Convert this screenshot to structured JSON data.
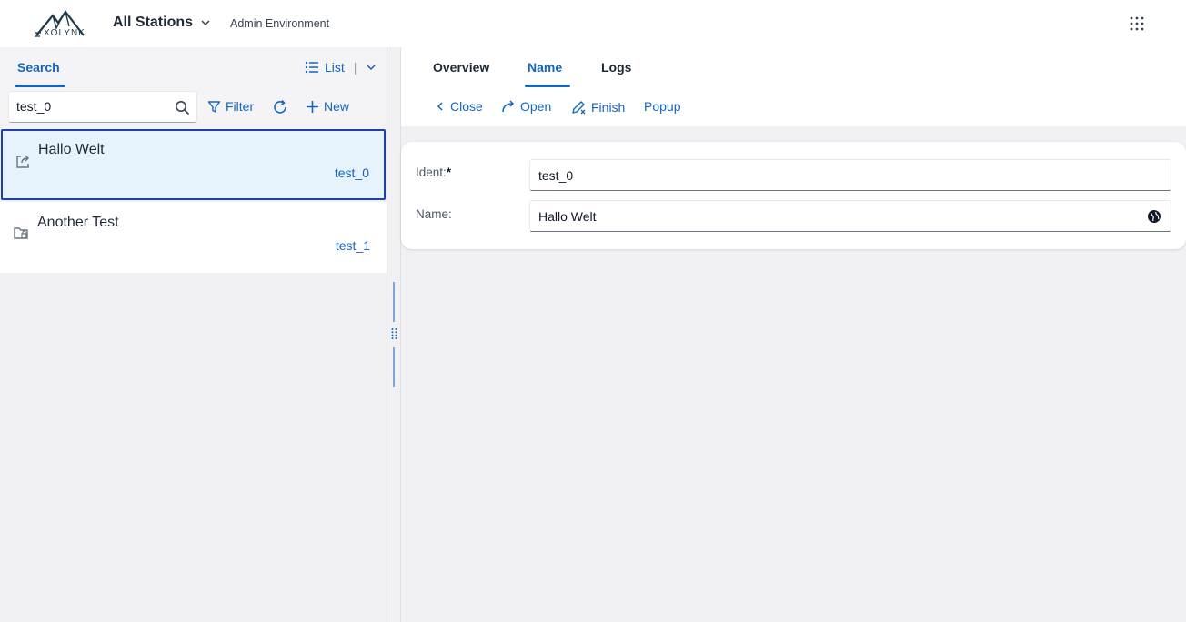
{
  "topbar": {
    "logo_text": "XOLYNK",
    "station_label": "All Stations",
    "environment": "Admin Environment"
  },
  "left": {
    "tab_search": "Search",
    "view_label": "List",
    "search_value": "test_0",
    "filter_label": "Filter",
    "new_label": "New",
    "items": [
      {
        "title": "Hallo Welt",
        "code": "test_0",
        "icon": "external-link-icon"
      },
      {
        "title": "Another Test",
        "code": "test_1",
        "icon": "folder-lock-icon"
      }
    ]
  },
  "right": {
    "tabs": [
      {
        "label": "Overview"
      },
      {
        "label": "Name"
      },
      {
        "label": "Logs"
      }
    ],
    "active_tab": "Name",
    "actions": {
      "close": "Close",
      "open": "Open",
      "finish": "Finish",
      "popup": "Popup"
    },
    "form": {
      "ident_label": "Ident:",
      "ident_required": "*",
      "ident_value": "test_0",
      "name_label": "Name:",
      "name_value": "Hallo Welt"
    }
  },
  "colors": {
    "accent": "#1565c0",
    "selected_bg": "#e6f3fc",
    "selected_border": "#1e40af"
  }
}
